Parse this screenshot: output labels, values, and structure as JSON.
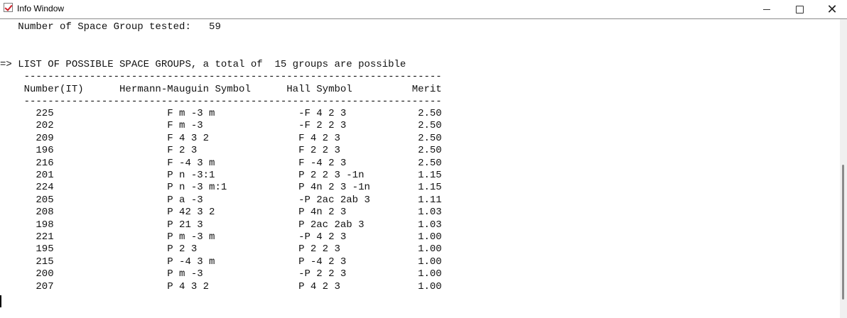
{
  "window": {
    "title": "Info Window",
    "buttons": {
      "minimize": "—",
      "maximize": "☐",
      "close": "✕"
    }
  },
  "console": {
    "tested_line": "   Number of Space Group tested:   59",
    "list_header": "=> LIST OF POSSIBLE SPACE GROUPS, a total of  15 groups are possible",
    "rule": "    ----------------------------------------------------------------------",
    "columns": "    Number(IT)      Hermann-Mauguin Symbol      Hall Symbol          Merit",
    "rows": [
      "      225                   F m -3 m              -F 4 2 3            2.50",
      "      202                   F m -3                -F 2 2 3            2.50",
      "      209                   F 4 3 2               F 4 2 3             2.50",
      "      196                   F 2 3                 F 2 2 3             2.50",
      "      216                   F -4 3 m              F -4 2 3            2.50",
      "      201                   P n -3:1              P 2 2 3 -1n         1.15",
      "      224                   P n -3 m:1            P 4n 2 3 -1n        1.15",
      "      205                   P a -3                -P 2ac 2ab 3        1.11",
      "      208                   P 42 3 2              P 4n 2 3            1.03",
      "      198                   P 21 3                P 2ac 2ab 3         1.03",
      "      221                   P m -3 m              -P 4 2 3            1.00",
      "      195                   P 2 3                 P 2 2 3             1.00",
      "      215                   P -4 3 m              P -4 2 3            1.00",
      "      200                   P m -3                -P 2 2 3            1.00",
      "      207                   P 4 3 2               P 4 2 3             1.00"
    ]
  }
}
